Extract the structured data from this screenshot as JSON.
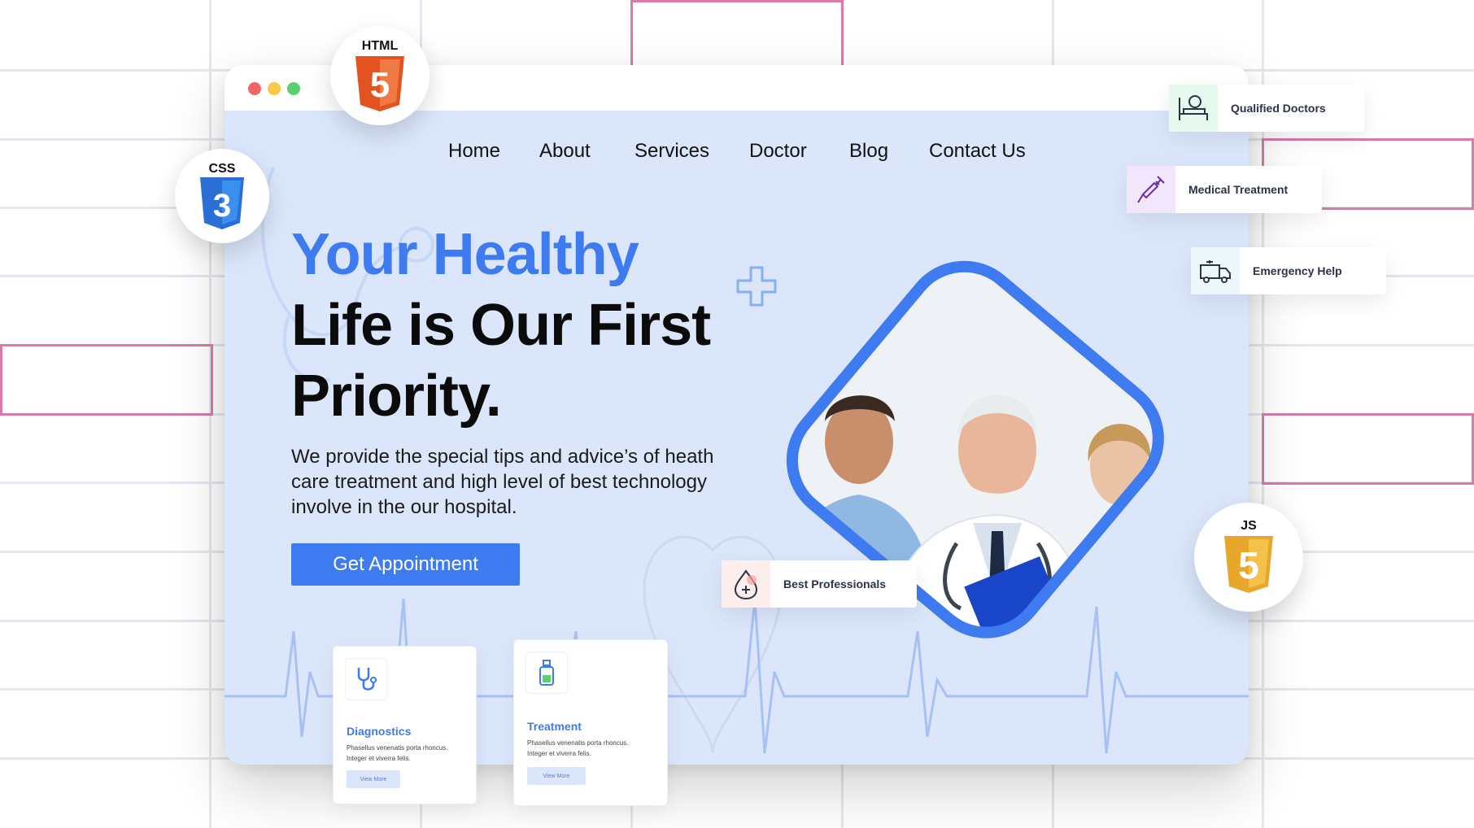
{
  "badges": {
    "html": "HTML",
    "html_number": "5",
    "css": "CSS",
    "css_number": "3",
    "js": "JS",
    "js_number": "5"
  },
  "nav": {
    "items": [
      "Home",
      "About",
      "Services",
      "Doctor",
      "Blog",
      "Contact Us"
    ]
  },
  "hero": {
    "title_line1": "Your Healthy",
    "title_line2": "Life is Our First",
    "title_line3": "Priority.",
    "description": "We provide the special tips and advice’s of heath care treatment and high level of best technology involve in the our hospital.",
    "cta": "Get Appointment"
  },
  "cards": [
    {
      "title": "Diagnostics",
      "text": "Phasellus venenatis porta rhoncus. Integer et viverra felis.",
      "button": "View More",
      "icon": "stethoscope-icon"
    },
    {
      "title": "Treatment",
      "text": "Phasellus venenatis porta rhoncus. Integer et viverra felis.",
      "button": "View More",
      "icon": "bottle-icon"
    }
  ],
  "tags": {
    "qualified": "Qualified Doctors",
    "medical": "Medical Treatment",
    "emergency": "Emergency Help",
    "professionals": "Best Professionals"
  },
  "colors": {
    "accent": "#3e7af0",
    "page_bg": "#dbe6fb",
    "dot_red": "#f26466",
    "dot_yellow": "#f7c948",
    "dot_green": "#5ccf74",
    "html_orange": "#e4521f",
    "css_blue": "#2a6fd6",
    "js_yellow": "#e6a72a",
    "grid_pink": "#d97aaa"
  }
}
